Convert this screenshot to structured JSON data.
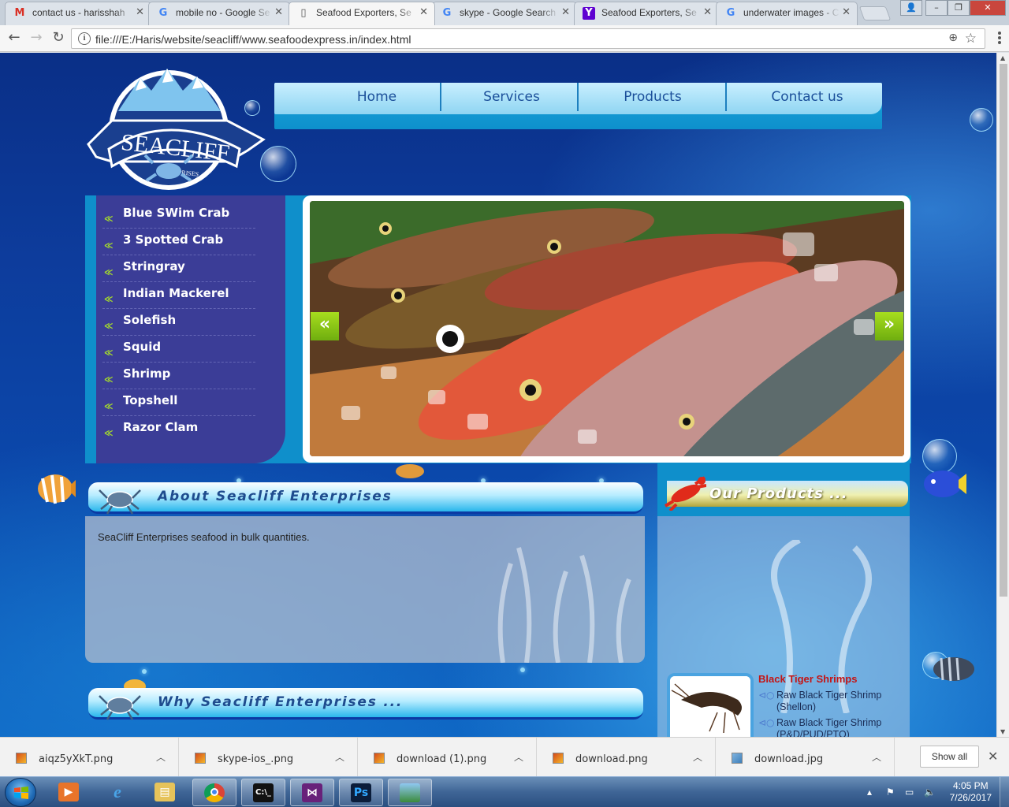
{
  "browser": {
    "tabs": [
      {
        "title": "contact us - harisshah",
        "icon": "gmail-icon",
        "active": false
      },
      {
        "title": "mobile no - Google Se",
        "icon": "google-icon",
        "active": false
      },
      {
        "title": "Seafood Exporters, Se",
        "icon": "page-icon",
        "active": true
      },
      {
        "title": "skype - Google Search",
        "icon": "google-icon",
        "active": false
      },
      {
        "title": "Seafood Exporters, Se",
        "icon": "yahoo-icon",
        "active": false
      },
      {
        "title": "underwater images - C",
        "icon": "google-icon",
        "active": false
      }
    ],
    "url": "file:///E:/Haris/website/seacliff/www.seafoodexpress.in/index.html"
  },
  "site": {
    "logo": {
      "name": "SEACLIFF",
      "sub": "ENTERPRISES"
    },
    "nav": [
      "Home",
      "Services",
      "Products",
      "Contact us"
    ],
    "side_menu": [
      "Blue SWim Crab",
      "3 Spotted Crab",
      "Stringray",
      "Indian Mackerel",
      "Solefish",
      "Squid",
      "Shrimp",
      "Topshell",
      "Razor Clam"
    ],
    "slider": {
      "prev": "«",
      "next": "»"
    },
    "about": {
      "title": "About Seacliff Enterprises",
      "text": "SeaCliff Enterprises seafood in bulk quantities."
    },
    "why": {
      "title": "Why Seacliff Enterprises ..."
    },
    "products": {
      "title": "Our Products ...",
      "item_title": "Black Tiger Shrimps",
      "lines": [
        [
          "Raw Black Tiger Shrimp",
          "(Shellon)"
        ],
        [
          "Raw Black Tiger Shrimp",
          "(P&D/PUD/PTO)"
        ]
      ]
    }
  },
  "downloads": {
    "items": [
      "aiqz5yXkT.png",
      "skype-ios_.png",
      "download (1).png",
      "download.png",
      "download.jpg"
    ],
    "show_all": "Show all"
  },
  "taskbar": {
    "time": "4:05 PM",
    "date": "7/26/2017"
  }
}
